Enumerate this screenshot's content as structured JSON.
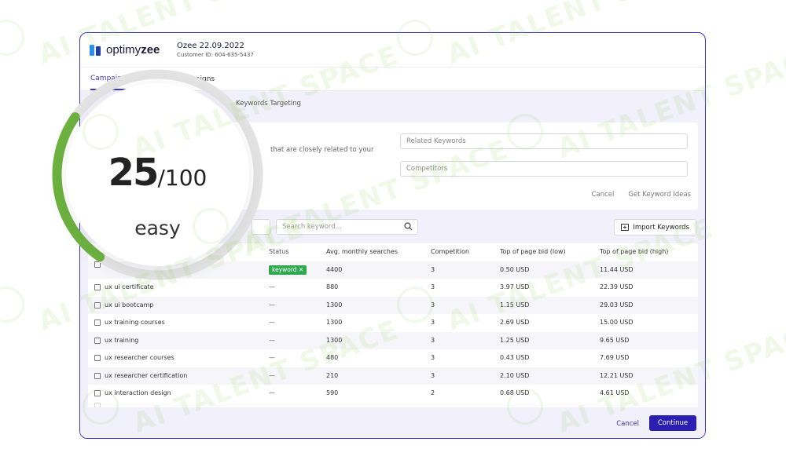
{
  "app": {
    "logo_text_plain": "optimy",
    "logo_text_bold": "zee",
    "customer_name": "Ozee 22.09.2022",
    "customer_id": "Customer ID: 604-635-5437"
  },
  "tabs": [
    {
      "label": "Campaign",
      "active": true
    },
    {
      "label": "Campaigns",
      "active": false
    }
  ],
  "breadcrumb": "Keywords Targeting",
  "ideas": {
    "description": "that are closely related to your",
    "related_placeholder": "Related Keywords",
    "competitors_placeholder": "Competitors",
    "cancel_label": "Cancel",
    "get_ideas_label": "Get Keyword Ideas"
  },
  "search": {
    "placeholder": "Search keyword..."
  },
  "import_label": "Import Keywords",
  "table": {
    "headers": {
      "status": "Status",
      "avg": "Avg. monthly searches",
      "competition": "Competition",
      "low": "Top of page bid (low)",
      "high": "Top of page bid (high)"
    },
    "rows": [
      {
        "keyword": "",
        "status": "keyword",
        "chip": true,
        "avg": "4400",
        "competition": "3",
        "low": "0.50 USD",
        "high": "11.44 USD"
      },
      {
        "keyword": "ux ui certificate",
        "status": "—",
        "avg": "880",
        "competition": "3",
        "low": "3.97 USD",
        "high": "22.39 USD"
      },
      {
        "keyword": "ux ui bootcamp",
        "status": "—",
        "avg": "1300",
        "competition": "3",
        "low": "1.15 USD",
        "high": "29.03 USD"
      },
      {
        "keyword": "ux training courses",
        "status": "—",
        "avg": "1300",
        "competition": "3",
        "low": "2.69 USD",
        "high": "15.00 USD"
      },
      {
        "keyword": "ux training",
        "status": "—",
        "avg": "1300",
        "competition": "3",
        "low": "1.25 USD",
        "high": "9.65 USD"
      },
      {
        "keyword": "ux researcher courses",
        "status": "—",
        "avg": "480",
        "competition": "3",
        "low": "0.43 USD",
        "high": "7.69 USD"
      },
      {
        "keyword": "ux researcher certification",
        "status": "—",
        "avg": "210",
        "competition": "3",
        "low": "2.10 USD",
        "high": "12.21 USD"
      },
      {
        "keyword": "ux interaction design",
        "status": "—",
        "avg": "590",
        "competition": "2",
        "low": "0.68 USD",
        "high": "4.61 USD"
      }
    ]
  },
  "footer": {
    "cancel_label": "Cancel",
    "continue_label": "Continue"
  },
  "score": {
    "value": "25",
    "max": "/100",
    "label": "easy",
    "fraction": 0.25,
    "accent": "#6db33f"
  },
  "colors": {
    "primary": "#3f35c9",
    "chip": "#2fa84f",
    "gauge": "#6db33f"
  },
  "watermark": "AI TALENT SPACE"
}
